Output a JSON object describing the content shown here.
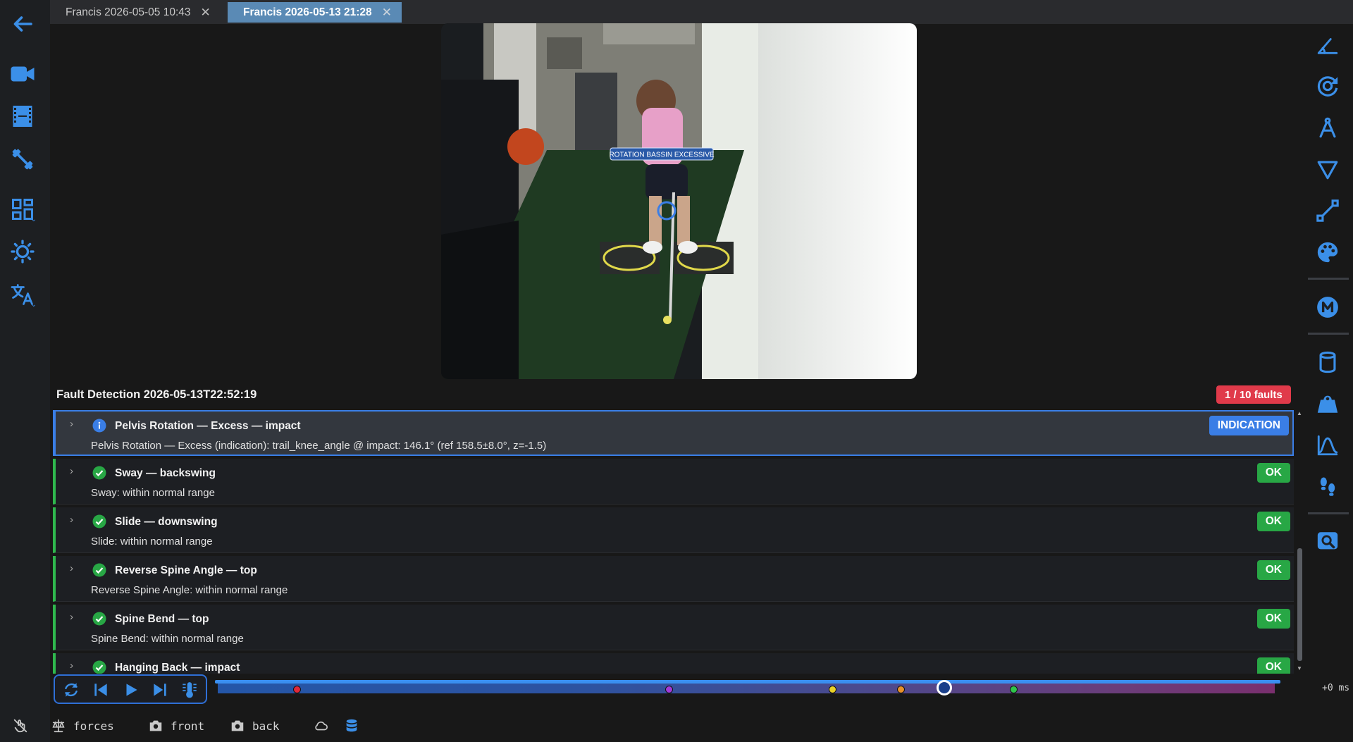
{
  "tabs": [
    {
      "label": "Francis 2026-05-05 10:43",
      "close": "✕",
      "active": false
    },
    {
      "label": "Francis 2026-05-13 21:28",
      "close": "✕",
      "active": true
    }
  ],
  "video": {
    "overlay_label": "ROTATION BASSIN EXCESSIVE"
  },
  "fault_panel": {
    "title": "Fault Detection 2026-05-13T22:52:19",
    "fault_count": "1 / 10 faults",
    "rows": [
      {
        "title": "Pelvis Rotation — Excess — impact",
        "description": "Pelvis Rotation — Excess (indication): trail_knee_angle @ impact: 146.1° (ref 158.5±8.0°, z=-1.5)",
        "badge": "INDICATION",
        "status": "info"
      },
      {
        "title": "Sway — backswing",
        "description": "Sway: within normal range",
        "badge": "OK",
        "status": "ok"
      },
      {
        "title": "Slide — downswing",
        "description": "Slide: within normal range",
        "badge": "OK",
        "status": "ok"
      },
      {
        "title": "Reverse Spine Angle — top",
        "description": "Reverse Spine Angle: within normal range",
        "badge": "OK",
        "status": "ok"
      },
      {
        "title": "Spine Bend — top",
        "description": "Spine Bend: within normal range",
        "badge": "OK",
        "status": "ok"
      },
      {
        "title": "Hanging Back — impact",
        "description": "",
        "badge": "OK",
        "status": "ok"
      }
    ],
    "chevron": "›"
  },
  "timeline": {
    "offset": "+0 ms",
    "marker_colors": [
      "#e0293a",
      "#a23ad8",
      "#e8d028",
      "#e8902a",
      "#2fc44a"
    ]
  },
  "bottom_bar": {
    "forces_label": "forces",
    "front_label": "front",
    "back_label": "back"
  },
  "colors": {
    "accent": "#3a7ee6",
    "ok": "#28a745",
    "fault": "#e03a4a",
    "icon_blue": "#3b8fe8"
  }
}
